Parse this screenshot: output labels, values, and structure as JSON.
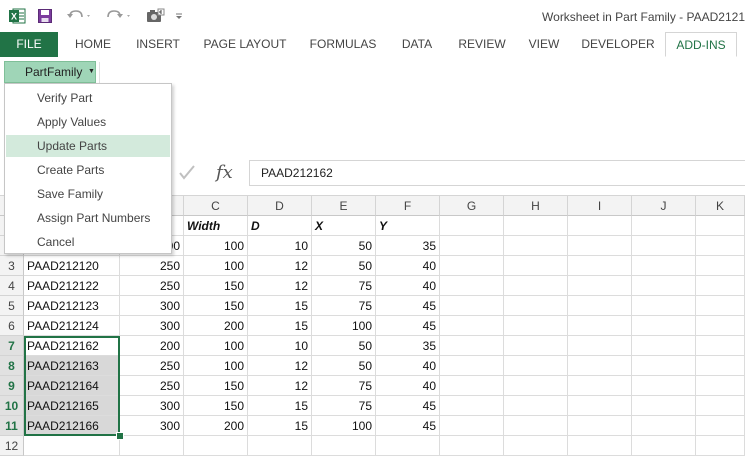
{
  "window": {
    "title": "Worksheet in Part Family - PAAD2121"
  },
  "ribbon_tabs": [
    "FILE",
    "HOME",
    "INSERT",
    "PAGE LAYOUT",
    "FORMULAS",
    "DATA",
    "REVIEW",
    "VIEW",
    "DEVELOPER",
    "ADD-INS"
  ],
  "active_tab": "ADD-INS",
  "addin": {
    "button_label": "PartFamily"
  },
  "menu": {
    "items": [
      "Verify Part",
      "Apply Values",
      "Update Parts",
      "Create Parts",
      "Save Family",
      "Assign Part Numbers",
      "Cancel"
    ],
    "highlighted": "Update Parts"
  },
  "formula_bar": {
    "fx": "fx",
    "value": "PAAD212162"
  },
  "grid": {
    "columns": [
      "C",
      "D",
      "E",
      "F",
      "G",
      "H",
      "I",
      "J",
      "K"
    ],
    "header_row": {
      "row": "",
      "b": "",
      "c": "Width",
      "d": "D",
      "e": "X",
      "f": "Y"
    },
    "rows": [
      {
        "row": "",
        "a": "",
        "b": "00",
        "c": "100",
        "d": "10",
        "e": "50",
        "f": "35"
      },
      {
        "row": "3",
        "a": "PAAD212120",
        "b": "250",
        "c": "100",
        "d": "12",
        "e": "50",
        "f": "40"
      },
      {
        "row": "4",
        "a": "PAAD212122",
        "b": "250",
        "c": "150",
        "d": "12",
        "e": "75",
        "f": "40"
      },
      {
        "row": "5",
        "a": "PAAD212123",
        "b": "300",
        "c": "150",
        "d": "15",
        "e": "75",
        "f": "45"
      },
      {
        "row": "6",
        "a": "PAAD212124",
        "b": "300",
        "c": "200",
        "d": "15",
        "e": "100",
        "f": "45"
      },
      {
        "row": "7",
        "a": "PAAD212162",
        "b": "200",
        "c": "100",
        "d": "10",
        "e": "50",
        "f": "35"
      },
      {
        "row": "8",
        "a": "PAAD212163",
        "b": "250",
        "c": "100",
        "d": "12",
        "e": "50",
        "f": "40"
      },
      {
        "row": "9",
        "a": "PAAD212164",
        "b": "250",
        "c": "150",
        "d": "12",
        "e": "75",
        "f": "40"
      },
      {
        "row": "10",
        "a": "PAAD212165",
        "b": "300",
        "c": "150",
        "d": "15",
        "e": "75",
        "f": "45"
      },
      {
        "row": "11",
        "a": "PAAD212166",
        "b": "300",
        "c": "200",
        "d": "15",
        "e": "100",
        "f": "45"
      },
      {
        "row": "12",
        "a": "",
        "b": "",
        "c": "",
        "d": "",
        "e": "",
        "f": ""
      }
    ],
    "selected_rows": [
      "7",
      "8",
      "9",
      "10",
      "11"
    ]
  },
  "colors": {
    "excel_green": "#217346",
    "menu_highlight": "#d3eadc",
    "addin_button": "#9fd5b7"
  }
}
